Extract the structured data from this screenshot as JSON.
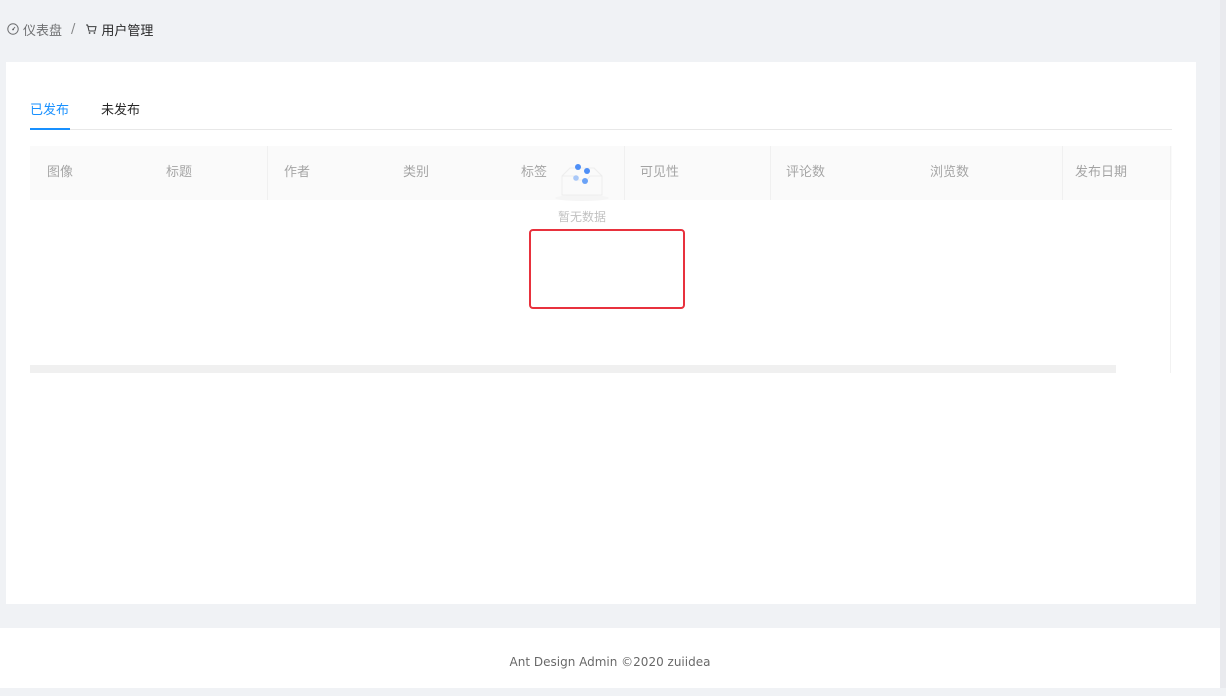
{
  "breadcrumb": {
    "home_label": "仪表盘",
    "separator": "/",
    "current_label": "用户管理",
    "home_icon": "dashboard-icon",
    "current_icon": "shopping-cart-icon"
  },
  "tabs": [
    {
      "label": "已发布",
      "active": true
    },
    {
      "label": "未发布",
      "active": false
    }
  ],
  "table": {
    "columns": [
      "图像",
      "标题",
      "作者",
      "类别",
      "标签",
      "可见性",
      "评论数",
      "浏览数",
      "发布日期"
    ],
    "empty_text": "暂无数据",
    "empty_icon": "empty-inbox-icon"
  },
  "footer": {
    "text": "Ant Design Admin ©2020 zuiidea"
  },
  "colors": {
    "accent": "#1890ff",
    "highlight": "#e8313d",
    "background": "#f0f2f5"
  }
}
